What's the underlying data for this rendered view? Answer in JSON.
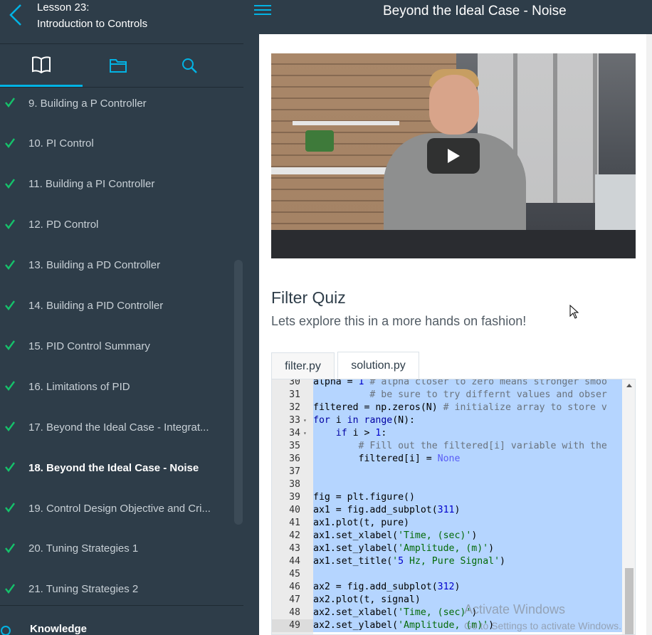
{
  "sidebar": {
    "lesson_number": "Lesson 23:",
    "lesson_title": "Introduction to Controls",
    "tabs": [
      {
        "name": "lessons",
        "icon": "book-icon",
        "active": true
      },
      {
        "name": "resources",
        "icon": "folder-icon",
        "active": false
      },
      {
        "name": "search",
        "icon": "search-icon",
        "active": false
      }
    ],
    "concepts": [
      {
        "label": "9. Building a P Controller",
        "completed": true,
        "current": false
      },
      {
        "label": "10. PI Control",
        "completed": true,
        "current": false
      },
      {
        "label": "11. Building a PI Controller",
        "completed": true,
        "current": false
      },
      {
        "label": "12. PD Control",
        "completed": true,
        "current": false
      },
      {
        "label": "13. Building a PD Controller",
        "completed": true,
        "current": false
      },
      {
        "label": "14. Building a PID Controller",
        "completed": true,
        "current": false
      },
      {
        "label": "15. PID Control Summary",
        "completed": true,
        "current": false
      },
      {
        "label": "16. Limitations of PID",
        "completed": true,
        "current": false
      },
      {
        "label": "17. Beyond the Ideal Case - Integrat...",
        "completed": true,
        "current": false
      },
      {
        "label": "18. Beyond the Ideal Case - Noise",
        "completed": true,
        "current": true
      },
      {
        "label": "19. Control Design Objective and Cri...",
        "completed": true,
        "current": false
      },
      {
        "label": "20. Tuning Strategies 1",
        "completed": true,
        "current": false
      },
      {
        "label": "21. Tuning Strategies 2",
        "completed": true,
        "current": false
      }
    ],
    "knowledge_label": "Knowledge"
  },
  "header": {
    "title": "Beyond the Ideal Case - Noise"
  },
  "main": {
    "quiz_title": "Filter Quiz",
    "quiz_subtitle": "Lets explore this in a more hands on fashion!",
    "editor_tabs": [
      {
        "label": "filter.py",
        "active": true
      },
      {
        "label": "solution.py",
        "active": false
      }
    ],
    "code_lines": [
      {
        "num": "30",
        "fold": false,
        "text": "alpha = 1 # alpha closer to zero means stronger smoo"
      },
      {
        "num": "31",
        "fold": false,
        "text": "          # be sure to try differnt values and obser"
      },
      {
        "num": "32",
        "fold": false,
        "text": "filtered = np.zeros(N) # initialize array to store v"
      },
      {
        "num": "33",
        "fold": true,
        "text": "for i in range(N):"
      },
      {
        "num": "34",
        "fold": true,
        "text": "    if i > 1:"
      },
      {
        "num": "35",
        "fold": false,
        "text": "        # Fill out the filtered[i] variable with the"
      },
      {
        "num": "36",
        "fold": false,
        "text": "        filtered[i] = None"
      },
      {
        "num": "37",
        "fold": false,
        "text": ""
      },
      {
        "num": "38",
        "fold": false,
        "text": ""
      },
      {
        "num": "39",
        "fold": false,
        "text": "fig = plt.figure()"
      },
      {
        "num": "40",
        "fold": false,
        "text": "ax1 = fig.add_subplot(311)"
      },
      {
        "num": "41",
        "fold": false,
        "text": "ax1.plot(t, pure)"
      },
      {
        "num": "42",
        "fold": false,
        "text": "ax1.set_xlabel('Time, (sec)')"
      },
      {
        "num": "43",
        "fold": false,
        "text": "ax1.set_ylabel('Amplitude, (m)')"
      },
      {
        "num": "44",
        "fold": false,
        "text": "ax1.set_title('5 Hz, Pure Signal')"
      },
      {
        "num": "45",
        "fold": false,
        "text": ""
      },
      {
        "num": "46",
        "fold": false,
        "text": "ax2 = fig.add_subplot(312)"
      },
      {
        "num": "47",
        "fold": false,
        "text": "ax2.plot(t, signal)"
      },
      {
        "num": "48",
        "fold": false,
        "text": "ax2.set_xlabel('Time, (sec)')"
      },
      {
        "num": "49",
        "fold": false,
        "text": "ax2.set_ylabel('Amplitude, (m)')"
      }
    ],
    "selection_end_line": "49"
  },
  "watermark": {
    "line1": "Activate Windows",
    "line2": "Go to Settings to activate Windows."
  },
  "colors": {
    "sidebar_bg": "#2e3d49",
    "accent": "#02b3e4",
    "check": "#15c26b",
    "selection": "#b5d5ff"
  }
}
